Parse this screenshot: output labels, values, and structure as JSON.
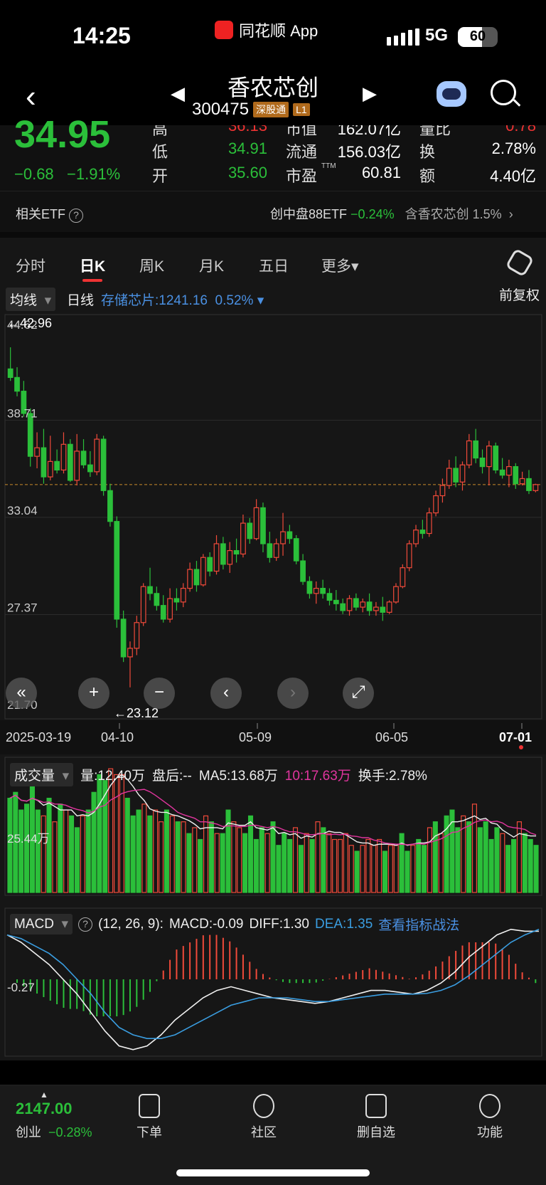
{
  "status": {
    "time": "14:25",
    "app_name": "同花顺 App",
    "network": "5G",
    "battery": 60
  },
  "header": {
    "stock_name": "香农芯创",
    "stock_code": "300475",
    "tag_connect": "深股通",
    "tag_level": "L1"
  },
  "quote": {
    "price": "34.95",
    "change": "−0.68",
    "change_pct": "−1.91%",
    "high_label": "高",
    "high_value": "36.13",
    "low_label": "低",
    "low_value": "34.91",
    "open_label": "开",
    "open_value": "35.60",
    "mktcap_label": "市值",
    "mktcap_value": "162.07亿",
    "float_label": "流通",
    "float_value": "156.03亿",
    "pe_label": "市盈",
    "pe_sup": "TTM",
    "pe_value": "60.81",
    "vr_label": "量比",
    "vr_value": "0.78",
    "turnover_label": "换",
    "turnover_value": "2.78%",
    "amount_label": "额",
    "amount_value": "4.40亿"
  },
  "etf": {
    "label": "相关ETF",
    "info_icon": "?",
    "etf_name": "创中盘88ETF",
    "etf_change": "−0.24%",
    "hold_label": "含香农芯创",
    "hold_pct": "1.5%"
  },
  "tabs": [
    "分时",
    "日K",
    "周K",
    "月K",
    "五日",
    "更多▾"
  ],
  "active_tab": 1,
  "kline_bar": {
    "ma_select": "均线",
    "period": "日线",
    "sector": "存储芯片:1241.16",
    "sector_pct": "0.52%",
    "adjust": "前复权"
  },
  "chart_data": [
    {
      "type": "candlestick",
      "y_ticks": [
        "44.62",
        "38.71",
        "33.04",
        "27.37",
        "21.70"
      ],
      "y_range": [
        21.7,
        44.62
      ],
      "max_label": "←42.96",
      "min_label": "←23.12",
      "ref_price": 34.95,
      "x_dates": [
        "2025-03-19",
        "04-10",
        "05-09",
        "06-05",
        "07-01"
      ],
      "candles": [
        [
          41.7,
          42.96,
          41.0,
          41.2
        ],
        [
          41.2,
          41.8,
          40.1,
          40.4
        ],
        [
          40.4,
          41.0,
          38.9,
          39.1
        ],
        [
          39.1,
          39.4,
          36.0,
          36.6
        ],
        [
          36.6,
          38.0,
          35.9,
          37.1
        ],
        [
          37.1,
          38.2,
          35.0,
          35.4
        ],
        [
          35.4,
          37.8,
          35.2,
          36.3
        ],
        [
          36.3,
          37.0,
          35.6,
          35.8
        ],
        [
          35.8,
          38.0,
          35.6,
          37.3
        ],
        [
          37.3,
          37.6,
          35.1,
          35.2
        ],
        [
          35.2,
          37.9,
          34.9,
          36.9
        ],
        [
          36.9,
          37.6,
          35.9,
          36.1
        ],
        [
          36.1,
          36.9,
          35.4,
          35.7
        ],
        [
          35.7,
          37.9,
          35.5,
          37.6
        ],
        [
          37.6,
          37.8,
          34.3,
          34.6
        ],
        [
          34.6,
          35.0,
          32.5,
          32.8
        ],
        [
          32.8,
          33.1,
          26.6,
          27.1
        ],
        [
          27.1,
          27.6,
          24.6,
          24.9
        ],
        [
          24.9,
          25.8,
          23.12,
          25.4
        ],
        [
          25.4,
          27.3,
          25.0,
          26.9
        ],
        [
          26.9,
          29.2,
          26.7,
          29.0
        ],
        [
          29.0,
          30.1,
          28.2,
          28.6
        ],
        [
          28.6,
          29.0,
          27.6,
          27.9
        ],
        [
          27.9,
          28.5,
          26.9,
          27.1
        ],
        [
          27.1,
          28.9,
          26.9,
          28.3
        ],
        [
          28.3,
          28.9,
          27.6,
          28.1
        ],
        [
          28.1,
          29.2,
          27.8,
          28.9
        ],
        [
          28.9,
          30.4,
          28.7,
          30.0
        ],
        [
          30.0,
          30.5,
          28.7,
          29.1
        ],
        [
          29.1,
          30.9,
          29.0,
          30.7
        ],
        [
          30.7,
          31.0,
          29.6,
          29.9
        ],
        [
          29.9,
          32.0,
          29.7,
          31.5
        ],
        [
          31.5,
          31.9,
          30.0,
          30.3
        ],
        [
          30.3,
          31.6,
          29.8,
          31.1
        ],
        [
          31.1,
          31.8,
          30.4,
          30.9
        ],
        [
          30.9,
          33.2,
          30.7,
          32.7
        ],
        [
          32.7,
          33.0,
          31.5,
          31.8
        ],
        [
          31.8,
          34.1,
          31.7,
          33.6
        ],
        [
          33.6,
          33.9,
          31.0,
          31.5
        ],
        [
          31.5,
          32.2,
          30.4,
          30.7
        ],
        [
          30.7,
          31.8,
          30.5,
          31.5
        ],
        [
          31.5,
          33.3,
          30.8,
          32.2
        ],
        [
          32.2,
          32.6,
          31.5,
          31.8
        ],
        [
          31.8,
          32.0,
          30.3,
          30.5
        ],
        [
          30.5,
          30.9,
          29.1,
          29.3
        ],
        [
          29.3,
          29.6,
          28.3,
          28.6
        ],
        [
          28.6,
          29.3,
          28.0,
          28.9
        ],
        [
          28.9,
          29.4,
          28.3,
          28.6
        ],
        [
          28.6,
          28.9,
          27.9,
          28.2
        ],
        [
          28.2,
          28.8,
          27.6,
          28.0
        ],
        [
          28.0,
          28.3,
          27.4,
          27.6
        ],
        [
          27.6,
          28.5,
          27.3,
          28.3
        ],
        [
          28.3,
          28.6,
          27.6,
          27.8
        ],
        [
          27.8,
          28.3,
          27.5,
          28.1
        ],
        [
          28.1,
          28.6,
          27.3,
          27.6
        ],
        [
          27.6,
          28.1,
          27.3,
          27.8
        ],
        [
          27.8,
          28.4,
          27.0,
          27.5
        ],
        [
          27.5,
          28.2,
          27.4,
          28.1
        ],
        [
          28.1,
          29.2,
          28.0,
          29.0
        ],
        [
          29.0,
          30.3,
          28.9,
          30.1
        ],
        [
          30.1,
          31.7,
          29.9,
          31.5
        ],
        [
          31.5,
          32.6,
          31.3,
          32.3
        ],
        [
          32.3,
          32.9,
          31.8,
          32.1
        ],
        [
          32.1,
          33.6,
          31.9,
          33.3
        ],
        [
          33.3,
          34.6,
          33.1,
          34.3
        ],
        [
          34.3,
          35.3,
          33.9,
          34.9
        ],
        [
          34.9,
          36.4,
          34.7,
          35.9
        ],
        [
          35.9,
          36.6,
          34.8,
          35.1
        ],
        [
          35.1,
          36.3,
          34.6,
          36.1
        ],
        [
          36.1,
          37.9,
          35.9,
          37.5
        ],
        [
          37.5,
          38.2,
          36.2,
          36.5
        ],
        [
          36.5,
          37.0,
          35.6,
          36.0
        ],
        [
          36.0,
          37.5,
          34.9,
          37.2
        ],
        [
          37.2,
          37.4,
          35.6,
          35.8
        ],
        [
          35.8,
          36.5,
          35.3,
          35.5
        ],
        [
          35.5,
          36.4,
          34.8,
          36.0
        ],
        [
          36.0,
          36.2,
          34.7,
          35.0
        ],
        [
          35.0,
          35.7,
          34.9,
          35.3
        ],
        [
          35.3,
          35.8,
          34.4,
          34.6
        ],
        [
          34.6,
          35.0,
          34.5,
          34.95
        ]
      ]
    },
    {
      "type": "volume",
      "indicator": "成交量",
      "vol": "量:12.40万",
      "after_hours": "盘后:--",
      "ma5": "MA5:13.68万",
      "ma10": "10:17.63万",
      "turnover": "换手:2.78%",
      "y_label": "25.44万",
      "values": [
        16,
        17,
        14,
        15,
        18,
        14,
        13,
        16,
        12,
        15,
        14,
        13,
        11,
        13,
        14,
        17,
        20,
        19,
        21,
        20,
        20,
        16,
        13,
        14,
        15,
        13,
        14,
        12,
        14,
        13,
        12,
        12,
        10,
        11,
        9,
        13,
        12,
        10,
        10,
        14,
        12,
        11,
        10,
        13,
        9,
        11,
        10,
        12,
        8,
        10,
        9,
        11,
        8,
        10,
        9,
        12,
        11,
        10,
        9,
        9,
        10,
        8,
        7,
        8,
        9,
        8,
        9,
        7,
        8,
        8,
        10,
        7,
        8,
        9,
        8,
        11,
        12,
        10,
        13,
        14,
        11,
        13,
        12,
        15,
        11,
        12,
        9,
        11,
        10,
        8,
        9,
        12,
        10,
        9,
        8
      ],
      "up": [
        0,
        0,
        0,
        0,
        0,
        0,
        1,
        0,
        1,
        0,
        1,
        0,
        0,
        1,
        0,
        0,
        0,
        0,
        1,
        1,
        1,
        0,
        0,
        0,
        1,
        0,
        1,
        1,
        0,
        1,
        0,
        1,
        0,
        1,
        0,
        1,
        0,
        1,
        0,
        0,
        1,
        1,
        0,
        0,
        0,
        0,
        1,
        0,
        0,
        0,
        0,
        1,
        0,
        1,
        0,
        1,
        0,
        1,
        1,
        1,
        1,
        1,
        0,
        1,
        1,
        1,
        1,
        0,
        1,
        1,
        0,
        0,
        1,
        0,
        0,
        1,
        0,
        1,
        0,
        0,
        0,
        1,
        0,
        1,
        0,
        0,
        0,
        0,
        1,
        0,
        0,
        1,
        0,
        0,
        0
      ]
    },
    {
      "type": "macd",
      "indicator": "MACD",
      "info_icon": "?",
      "params": "(12, 26, 9):",
      "macd": "MACD:-0.09",
      "diff": "DIFF:1.30",
      "dea": "DEA:1.35",
      "link": "查看指标战法",
      "y_label": "-0.27",
      "diff_series": [
        1.2,
        1.0,
        0.7,
        0.4,
        0.0,
        -0.4,
        -0.9,
        -1.4,
        -1.8,
        -1.9,
        -1.8,
        -1.5,
        -1.1,
        -0.8,
        -0.5,
        -0.3,
        -0.2,
        -0.3,
        -0.4,
        -0.5,
        -0.55,
        -0.6,
        -0.65,
        -0.6,
        -0.5,
        -0.4,
        -0.3,
        -0.3,
        -0.35,
        -0.4,
        -0.3,
        -0.1,
        0.2,
        0.6,
        0.9,
        1.2,
        1.35,
        1.3,
        1.3
      ],
      "dea_series": [
        1.2,
        1.1,
        0.9,
        0.7,
        0.4,
        0.0,
        -0.4,
        -0.9,
        -1.3,
        -1.5,
        -1.6,
        -1.6,
        -1.5,
        -1.3,
        -1.1,
        -0.9,
        -0.7,
        -0.6,
        -0.5,
        -0.5,
        -0.5,
        -0.55,
        -0.6,
        -0.6,
        -0.55,
        -0.5,
        -0.45,
        -0.4,
        -0.4,
        -0.4,
        -0.38,
        -0.3,
        -0.15,
        0.1,
        0.4,
        0.7,
        1.0,
        1.2,
        1.35
      ]
    }
  ],
  "chart_buttons": [
    "«",
    "+",
    "−",
    "‹",
    "›",
    "⤢"
  ],
  "bottom": {
    "index_value": "2147.00",
    "index_name": "创业",
    "index_change": "−0.28%",
    "items": [
      "下单",
      "社区",
      "删自选",
      "功能"
    ]
  }
}
